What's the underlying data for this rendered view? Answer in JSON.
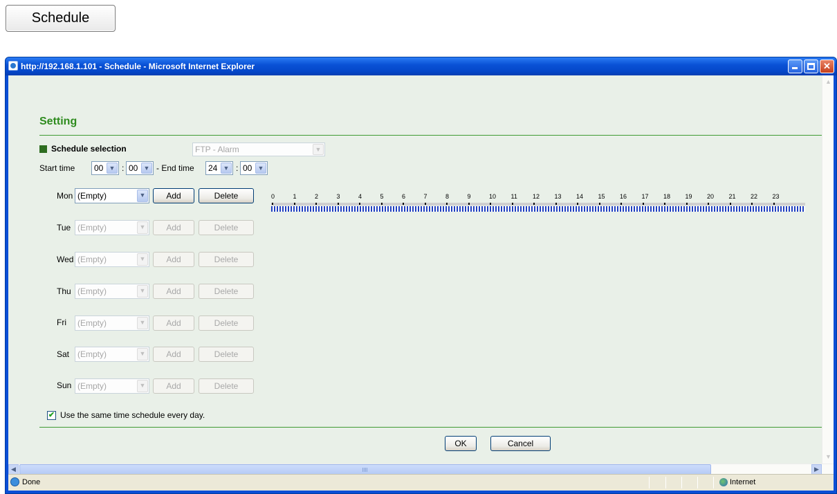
{
  "top_button": {
    "label": "Schedule"
  },
  "window": {
    "title": "http://192.168.1.101 - Schedule - Microsoft Internet Explorer",
    "controls": {
      "minimize_icon": "minimize-icon",
      "maximize_icon": "maximize-icon",
      "close_icon": "close-icon"
    }
  },
  "setting": {
    "heading": "Setting",
    "schedule_selection": {
      "label": "Schedule selection",
      "value": "FTP - Alarm"
    },
    "time": {
      "start_label": "Start time",
      "start_hour": "00",
      "start_minute": "00",
      "separator": ":",
      "end_label": "- End time",
      "end_hour": "24",
      "end_minute": "00"
    },
    "days": [
      {
        "label": "Mon",
        "value": "(Empty)",
        "add": "Add",
        "delete": "Delete"
      },
      {
        "label": "Tue",
        "value": "(Empty)",
        "add": "Add",
        "delete": "Delete"
      },
      {
        "label": "Wed",
        "value": "(Empty)",
        "add": "Add",
        "delete": "Delete"
      },
      {
        "label": "Thu",
        "value": "(Empty)",
        "add": "Add",
        "delete": "Delete"
      },
      {
        "label": "Fri",
        "value": "(Empty)",
        "add": "Add",
        "delete": "Delete"
      },
      {
        "label": "Sat",
        "value": "(Empty)",
        "add": "Add",
        "delete": "Delete"
      },
      {
        "label": "Sun",
        "value": "(Empty)",
        "add": "Add",
        "delete": "Delete"
      }
    ],
    "hour_labels": [
      "0",
      "1",
      "2",
      "3",
      "4",
      "5",
      "6",
      "7",
      "8",
      "9",
      "10",
      "11",
      "12",
      "13",
      "14",
      "15",
      "16",
      "17",
      "18",
      "19",
      "20",
      "21",
      "22",
      "23"
    ],
    "same_schedule": {
      "checked": true,
      "label": "Use the same time schedule every day."
    },
    "ok": "OK",
    "cancel": "Cancel"
  },
  "statusbar": {
    "text": "Done",
    "zone": "Internet"
  },
  "colors": {
    "accent_green": "#2e8b1e",
    "window_blue": "#0a4ed6",
    "content_bg": "#e9f0e8"
  }
}
